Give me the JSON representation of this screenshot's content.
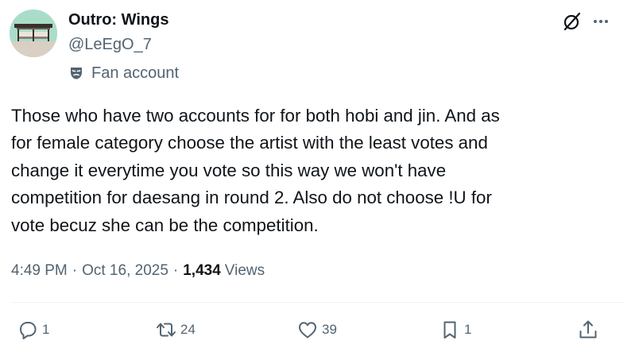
{
  "author": {
    "display_name": "Outro: Wings",
    "handle": "@LeEgO_7",
    "label": "Fan account",
    "label_icon": "theater-mask-icon"
  },
  "header_actions": {
    "grok_icon": "grok-icon",
    "more_icon": "more-icon"
  },
  "tweet": {
    "text": "Those who have two accounts for for both hobi and jin. And as\nfor female category choose the artist with the least votes and\nchange it everytime you vote so this way we won't have\ncompetition for daesang in round 2. Also do not choose !U for\nvote becuz she can be the competition.",
    "time": "4:49 PM",
    "separator": "·",
    "date": "Oct 16, 2025",
    "views_count": "1,434",
    "views_label": "Views"
  },
  "actions": {
    "replies": "1",
    "reposts": "24",
    "likes": "39",
    "bookmarks": "1"
  },
  "colors": {
    "text_primary": "#0f1419",
    "text_secondary": "#536471",
    "divider": "#eff3f4"
  }
}
